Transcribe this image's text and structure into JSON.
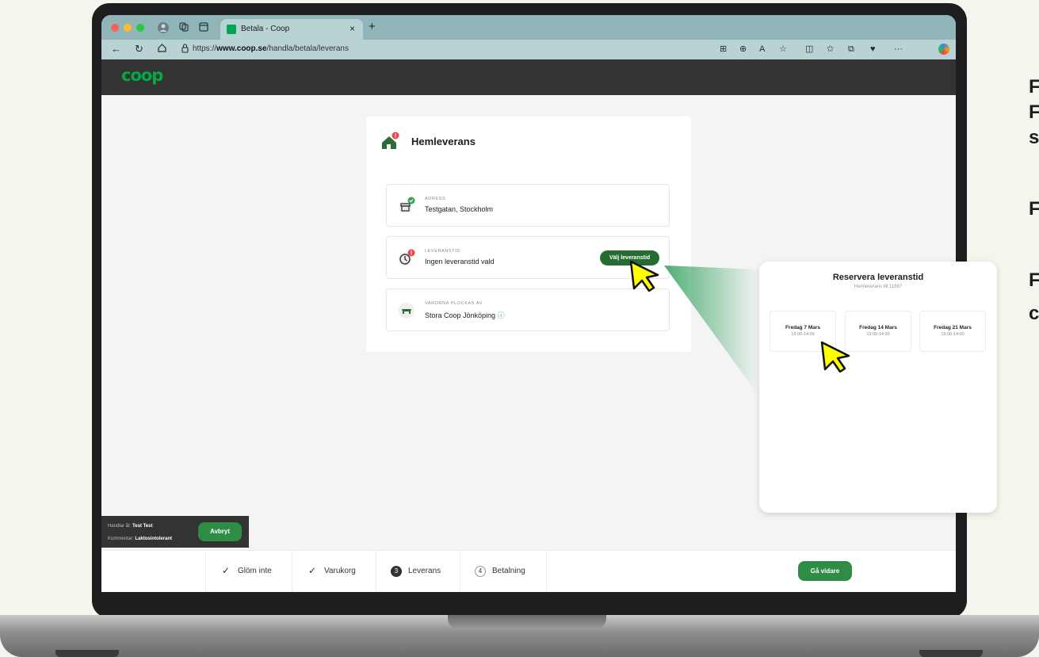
{
  "browser": {
    "tab_title": "Betala - Coop",
    "tab_close": "×",
    "new_tab": "+",
    "url_scheme": "https://",
    "url_host": "www.coop.se",
    "url_path": "/handla/betala/leverans"
  },
  "site": {
    "logo": "coop"
  },
  "checkout": {
    "title": "Hemleverans",
    "address": {
      "label": "ADRESS",
      "value": "Testgatan, Stockholm"
    },
    "delivery_time": {
      "label": "LEVERANSTID",
      "value": "Ingen leveranstid vald",
      "button": "Välj leveranstid"
    },
    "picked_by": {
      "label": "VARORNA PLOCKAS AV",
      "value": "Stora Coop Jönköping",
      "info_icon": "ⓘ"
    }
  },
  "shopper": {
    "shopping_for_label": "Handlar åt:",
    "shopping_for_value": "Test Test",
    "comment_label": "Kommentar:",
    "comment_value": "Laktosintolerant",
    "abort_button": "Avbryt"
  },
  "steps": [
    {
      "marker": "✓",
      "label": "Glöm inte",
      "state": "done"
    },
    {
      "marker": "✓",
      "label": "Varukorg",
      "state": "done"
    },
    {
      "marker": "3",
      "label": "Leverans",
      "state": "active"
    },
    {
      "marker": "4",
      "label": "Betalning",
      "state": "upcoming"
    }
  ],
  "next_button": "Gå vidare",
  "popup": {
    "title": "Reservera leveranstid",
    "subtitle": "Hemleverans till 11867",
    "slots": [
      {
        "day": "Fredag 7 Mars",
        "time": "13:00-14:00"
      },
      {
        "day": "Fredag 14 Mars",
        "time": "13:00-14:00"
      },
      {
        "day": "Fredag 21 Mars",
        "time": "13:00-14:00"
      }
    ]
  },
  "side_text": [
    "F",
    "F",
    "s",
    "F",
    "F",
    "c"
  ],
  "colors": {
    "brand_green": "#00aa46",
    "button_green": "#2f8c44",
    "header_dark": "#333333",
    "warning_red": "#e5484d",
    "check_green": "#34a853",
    "cursor_yellow": "#ffff00"
  }
}
